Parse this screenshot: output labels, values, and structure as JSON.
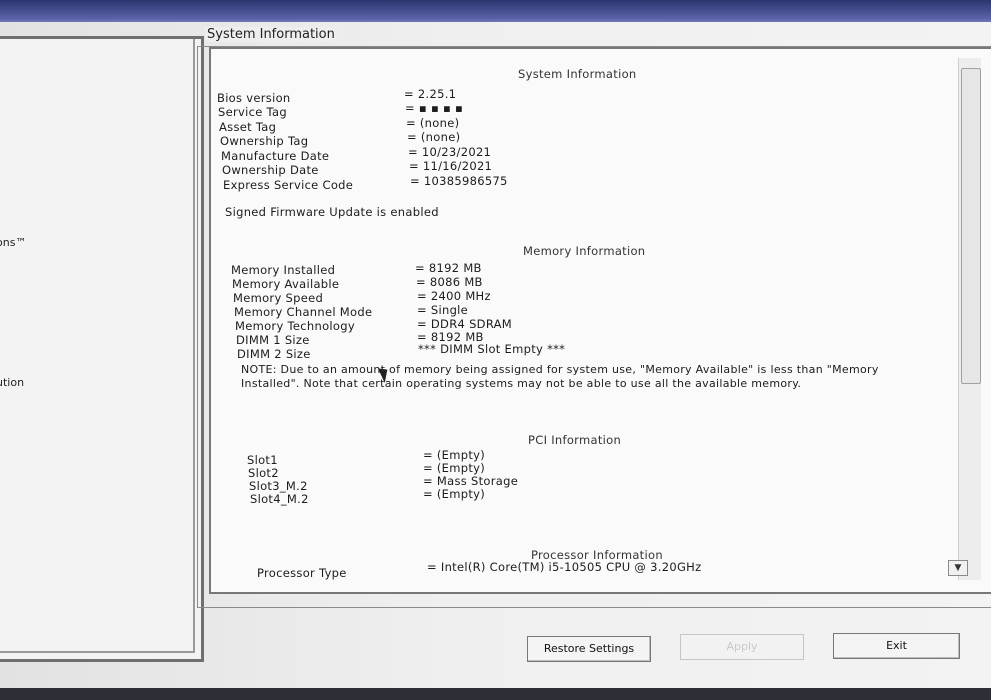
{
  "nav": {
    "item_partial_1": "ons™",
    "item_partial_2": "ution"
  },
  "groupbox": {
    "title": "System Information"
  },
  "system": {
    "title": "System Information",
    "rows": [
      {
        "label": "Bios version",
        "value": "= 2.25.1"
      },
      {
        "label": "Service Tag",
        "value": "= ▪ ▪ ▪ ▪"
      },
      {
        "label": "Asset Tag",
        "value": "= (none)"
      },
      {
        "label": "Ownership Tag",
        "value": "= (none)"
      },
      {
        "label": "Manufacture Date",
        "value": "= 10/23/2021"
      },
      {
        "label": "Ownership Date",
        "value": "= 11/16/2021"
      },
      {
        "label": "Express Service Code",
        "value": "= 10385986575"
      }
    ],
    "firmware_note": "Signed Firmware Update is enabled"
  },
  "memory": {
    "title": "Memory Information",
    "rows": [
      {
        "label": "Memory Installed",
        "value": "= 8192 MB"
      },
      {
        "label": "Memory Available",
        "value": "= 8086 MB"
      },
      {
        "label": "Memory Speed",
        "value": "= 2400 MHz"
      },
      {
        "label": "Memory Channel Mode",
        "value": "= Single"
      },
      {
        "label": "Memory Technology",
        "value": "= DDR4 SDRAM"
      },
      {
        "label": "DIMM 1 Size",
        "value": "= 8192 MB"
      },
      {
        "label": "DIMM 2 Size",
        "value": "*** DIMM Slot Empty ***"
      }
    ],
    "note": "NOTE: Due to an amount of memory being assigned for system use, \"Memory Available\" is less than \"Memory Installed\". Note that certain operating systems may not be able to use all the available memory."
  },
  "pci": {
    "title": "PCI Information",
    "rows": [
      {
        "label": "Slot1",
        "value": "= (Empty)"
      },
      {
        "label": "Slot2",
        "value": "= (Empty)"
      },
      {
        "label": "Slot3_M.2",
        "value": "= Mass Storage"
      },
      {
        "label": "Slot4_M.2",
        "value": "= (Empty)"
      }
    ]
  },
  "processor": {
    "title": "Processor Information",
    "rows": [
      {
        "label": "Processor Type",
        "value": "= Intel(R) Core(TM) i5-10505 CPU @ 3.20GHz"
      }
    ]
  },
  "buttons": {
    "restore": "Restore Settings",
    "apply": "Apply",
    "exit": "Exit"
  }
}
